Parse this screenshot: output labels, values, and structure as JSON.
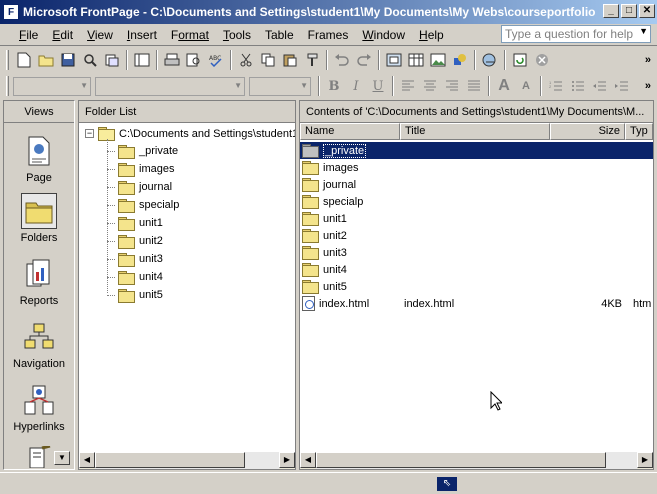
{
  "window": {
    "title": "Microsoft FrontPage - C:\\Documents and Settings\\student1\\My Documents\\My Webs\\courseportfolio",
    "app_icon_letter": "F",
    "minimize": "_",
    "maximize": "□",
    "close": "✕"
  },
  "menu": {
    "items": [
      {
        "first": "F",
        "rest": "ile"
      },
      {
        "first": "E",
        "rest": "dit"
      },
      {
        "first": "V",
        "rest": "iew"
      },
      {
        "first": "I",
        "rest": "nsert"
      },
      {
        "first": "F",
        "rest": "ormat"
      },
      {
        "first": "T",
        "rest": "ools"
      },
      {
        "first": "T",
        "rest": "able"
      },
      {
        "first": "F",
        "rest": "rames"
      },
      {
        "first": "W",
        "rest": "indow"
      },
      {
        "first": "H",
        "rest": "elp"
      }
    ],
    "help_placeholder": "Type a question for help"
  },
  "views": {
    "header": "Views",
    "items": [
      {
        "label": "Page",
        "icon": "page-view-icon"
      },
      {
        "label": "Folders",
        "icon": "folders-view-icon",
        "selected": true
      },
      {
        "label": "Reports",
        "icon": "reports-view-icon"
      },
      {
        "label": "Navigation",
        "icon": "navigation-view-icon"
      },
      {
        "label": "Hyperlinks",
        "icon": "hyperlinks-view-icon"
      }
    ]
  },
  "folder_list": {
    "header": "Folder List",
    "root": "C:\\Documents and Settings\\student1",
    "expander": "−",
    "folders": [
      "_private",
      "images",
      "journal",
      "specialp",
      "unit1",
      "unit2",
      "unit3",
      "unit4",
      "unit5"
    ]
  },
  "contents": {
    "header": "Contents of 'C:\\Documents and Settings\\student1\\My Documents\\M...",
    "columns": {
      "name": "Name",
      "title": "Title",
      "size": "Size",
      "type": "Typ"
    },
    "rows": [
      {
        "name": "_private",
        "title": "",
        "size": "",
        "type": "",
        "kind": "folder-gray",
        "selected": true
      },
      {
        "name": "images",
        "title": "",
        "size": "",
        "type": "",
        "kind": "folder"
      },
      {
        "name": "journal",
        "title": "",
        "size": "",
        "type": "",
        "kind": "folder"
      },
      {
        "name": "specialp",
        "title": "",
        "size": "",
        "type": "",
        "kind": "folder"
      },
      {
        "name": "unit1",
        "title": "",
        "size": "",
        "type": "",
        "kind": "folder"
      },
      {
        "name": "unit2",
        "title": "",
        "size": "",
        "type": "",
        "kind": "folder"
      },
      {
        "name": "unit3",
        "title": "",
        "size": "",
        "type": "",
        "kind": "folder"
      },
      {
        "name": "unit4",
        "title": "",
        "size": "",
        "type": "",
        "kind": "folder"
      },
      {
        "name": "unit5",
        "title": "",
        "size": "",
        "type": "",
        "kind": "folder"
      },
      {
        "name": "index.html",
        "title": "index.html",
        "size": "4KB",
        "type": "htm",
        "kind": "file"
      }
    ]
  },
  "colors": {
    "title_gradient_start": "#0a246a",
    "title_gradient_end": "#a6caf0",
    "selection": "#0a246a",
    "chrome": "#d4d0c8"
  }
}
